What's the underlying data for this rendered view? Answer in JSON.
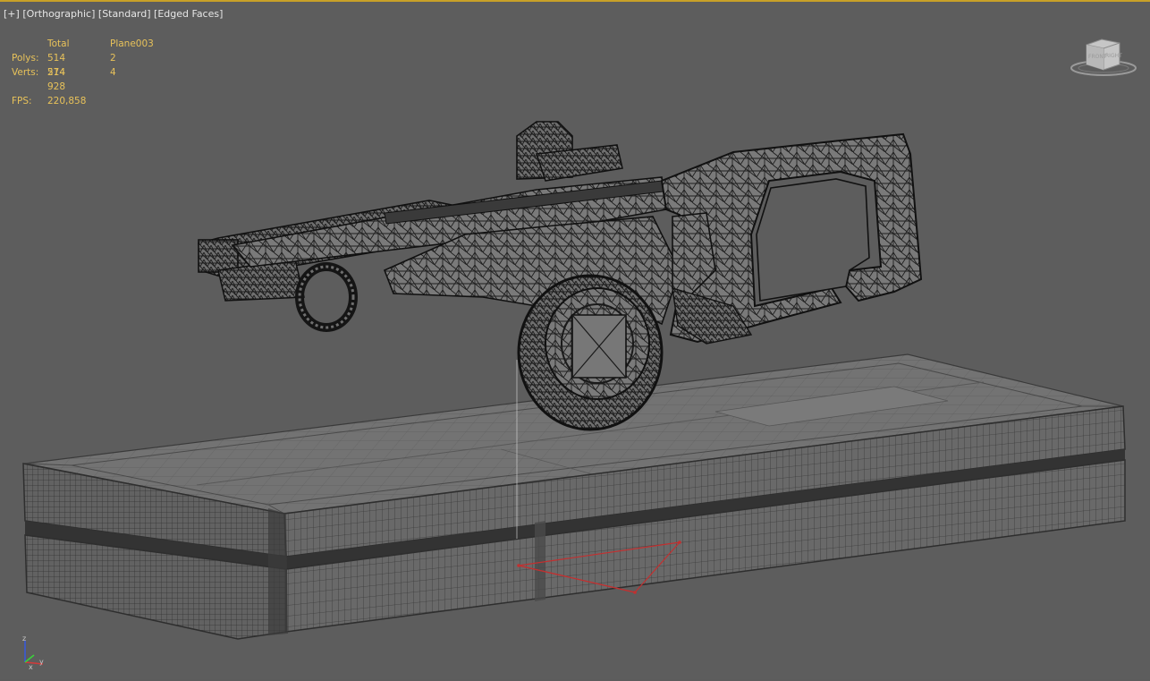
{
  "viewport": {
    "labels": {
      "plus": "[+]",
      "view": "[Orthographic]",
      "shading_standard": "[Standard]",
      "shading_mode": "[Edged Faces]"
    },
    "stats": {
      "header_total": "Total",
      "header_object": "Plane003",
      "polys_label": "Polys:",
      "polys_total": "514 514",
      "polys_object": "2",
      "verts_label": "Verts:",
      "verts_total": "274 928",
      "verts_object": "4",
      "fps_label": "FPS:",
      "fps_value": "220,858"
    },
    "viewcube": {
      "face_left": "FRONT",
      "face_right": "RIGHT",
      "icon": "viewcube-icon"
    },
    "axis": {
      "z": "z",
      "x": "x",
      "y": "y",
      "icon": "axis-tripod-icon"
    },
    "colors": {
      "background": "#5d5d5d",
      "active_border": "#c8a028",
      "stats_text": "#e8c25a",
      "label_text": "#e6e6e6",
      "wire": "#2a2a2a",
      "selection_red": "#c23030"
    }
  }
}
